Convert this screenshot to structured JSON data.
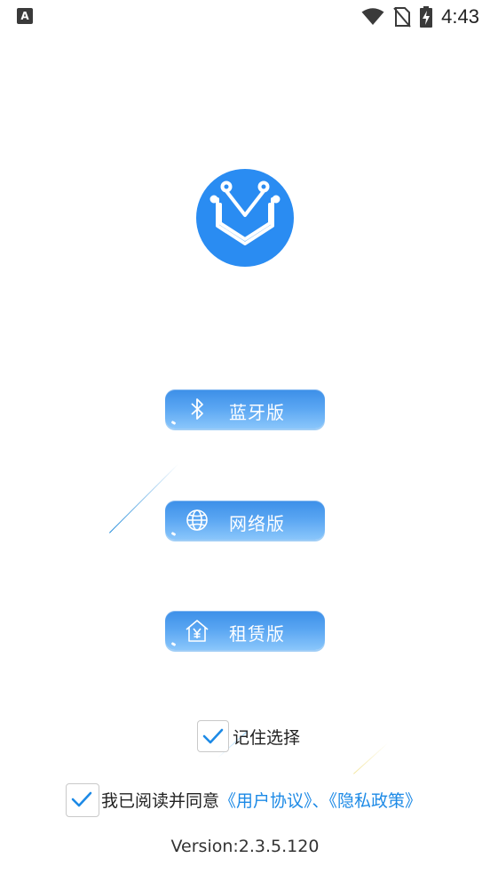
{
  "status_bar": {
    "notification_badge": "A",
    "time": "4:43",
    "icons": [
      "wifi-icon",
      "no-sim-icon",
      "battery-charging-icon"
    ]
  },
  "logo": {
    "icon": "circuit-v-logo-icon",
    "color": "#2a8cf2"
  },
  "modes": [
    {
      "label": "蓝牙版",
      "icon": "bluetooth-icon"
    },
    {
      "label": "网络版",
      "icon": "globe-icon"
    },
    {
      "label": "租赁版",
      "icon": "house-yen-icon"
    }
  ],
  "remember": {
    "checked": true,
    "label": "记住选择"
  },
  "agreement": {
    "checked": true,
    "prefix": "我已阅读并同意",
    "user_agreement": "《用户协议》",
    "separator": "、",
    "privacy_policy": "《隐私政策》"
  },
  "version": "Version:2.3.5.120",
  "colors": {
    "accent": "#1d8ae6",
    "button_top": "#3c8fe8",
    "button_bottom": "#8ac6fb"
  }
}
